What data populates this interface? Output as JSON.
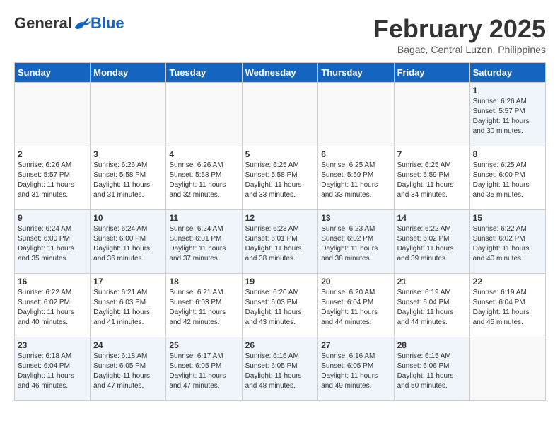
{
  "header": {
    "logo": {
      "general": "General",
      "blue": "Blue"
    },
    "title": "February 2025",
    "subtitle": "Bagac, Central Luzon, Philippines"
  },
  "calendar": {
    "days_of_week": [
      "Sunday",
      "Monday",
      "Tuesday",
      "Wednesday",
      "Thursday",
      "Friday",
      "Saturday"
    ],
    "weeks": [
      [
        {
          "day": "",
          "info": ""
        },
        {
          "day": "",
          "info": ""
        },
        {
          "day": "",
          "info": ""
        },
        {
          "day": "",
          "info": ""
        },
        {
          "day": "",
          "info": ""
        },
        {
          "day": "",
          "info": ""
        },
        {
          "day": "1",
          "info": "Sunrise: 6:26 AM\nSunset: 5:57 PM\nDaylight: 11 hours and 30 minutes."
        }
      ],
      [
        {
          "day": "2",
          "info": "Sunrise: 6:26 AM\nSunset: 5:57 PM\nDaylight: 11 hours and 31 minutes."
        },
        {
          "day": "3",
          "info": "Sunrise: 6:26 AM\nSunset: 5:58 PM\nDaylight: 11 hours and 31 minutes."
        },
        {
          "day": "4",
          "info": "Sunrise: 6:26 AM\nSunset: 5:58 PM\nDaylight: 11 hours and 32 minutes."
        },
        {
          "day": "5",
          "info": "Sunrise: 6:25 AM\nSunset: 5:58 PM\nDaylight: 11 hours and 33 minutes."
        },
        {
          "day": "6",
          "info": "Sunrise: 6:25 AM\nSunset: 5:59 PM\nDaylight: 11 hours and 33 minutes."
        },
        {
          "day": "7",
          "info": "Sunrise: 6:25 AM\nSunset: 5:59 PM\nDaylight: 11 hours and 34 minutes."
        },
        {
          "day": "8",
          "info": "Sunrise: 6:25 AM\nSunset: 6:00 PM\nDaylight: 11 hours and 35 minutes."
        }
      ],
      [
        {
          "day": "9",
          "info": "Sunrise: 6:24 AM\nSunset: 6:00 PM\nDaylight: 11 hours and 35 minutes."
        },
        {
          "day": "10",
          "info": "Sunrise: 6:24 AM\nSunset: 6:00 PM\nDaylight: 11 hours and 36 minutes."
        },
        {
          "day": "11",
          "info": "Sunrise: 6:24 AM\nSunset: 6:01 PM\nDaylight: 11 hours and 37 minutes."
        },
        {
          "day": "12",
          "info": "Sunrise: 6:23 AM\nSunset: 6:01 PM\nDaylight: 11 hours and 38 minutes."
        },
        {
          "day": "13",
          "info": "Sunrise: 6:23 AM\nSunset: 6:02 PM\nDaylight: 11 hours and 38 minutes."
        },
        {
          "day": "14",
          "info": "Sunrise: 6:22 AM\nSunset: 6:02 PM\nDaylight: 11 hours and 39 minutes."
        },
        {
          "day": "15",
          "info": "Sunrise: 6:22 AM\nSunset: 6:02 PM\nDaylight: 11 hours and 40 minutes."
        }
      ],
      [
        {
          "day": "16",
          "info": "Sunrise: 6:22 AM\nSunset: 6:02 PM\nDaylight: 11 hours and 40 minutes."
        },
        {
          "day": "17",
          "info": "Sunrise: 6:21 AM\nSunset: 6:03 PM\nDaylight: 11 hours and 41 minutes."
        },
        {
          "day": "18",
          "info": "Sunrise: 6:21 AM\nSunset: 6:03 PM\nDaylight: 11 hours and 42 minutes."
        },
        {
          "day": "19",
          "info": "Sunrise: 6:20 AM\nSunset: 6:03 PM\nDaylight: 11 hours and 43 minutes."
        },
        {
          "day": "20",
          "info": "Sunrise: 6:20 AM\nSunset: 6:04 PM\nDaylight: 11 hours and 44 minutes."
        },
        {
          "day": "21",
          "info": "Sunrise: 6:19 AM\nSunset: 6:04 PM\nDaylight: 11 hours and 44 minutes."
        },
        {
          "day": "22",
          "info": "Sunrise: 6:19 AM\nSunset: 6:04 PM\nDaylight: 11 hours and 45 minutes."
        }
      ],
      [
        {
          "day": "23",
          "info": "Sunrise: 6:18 AM\nSunset: 6:04 PM\nDaylight: 11 hours and 46 minutes."
        },
        {
          "day": "24",
          "info": "Sunrise: 6:18 AM\nSunset: 6:05 PM\nDaylight: 11 hours and 47 minutes."
        },
        {
          "day": "25",
          "info": "Sunrise: 6:17 AM\nSunset: 6:05 PM\nDaylight: 11 hours and 47 minutes."
        },
        {
          "day": "26",
          "info": "Sunrise: 6:16 AM\nSunset: 6:05 PM\nDaylight: 11 hours and 48 minutes."
        },
        {
          "day": "27",
          "info": "Sunrise: 6:16 AM\nSunset: 6:05 PM\nDaylight: 11 hours and 49 minutes."
        },
        {
          "day": "28",
          "info": "Sunrise: 6:15 AM\nSunset: 6:06 PM\nDaylight: 11 hours and 50 minutes."
        },
        {
          "day": "",
          "info": ""
        }
      ]
    ]
  }
}
